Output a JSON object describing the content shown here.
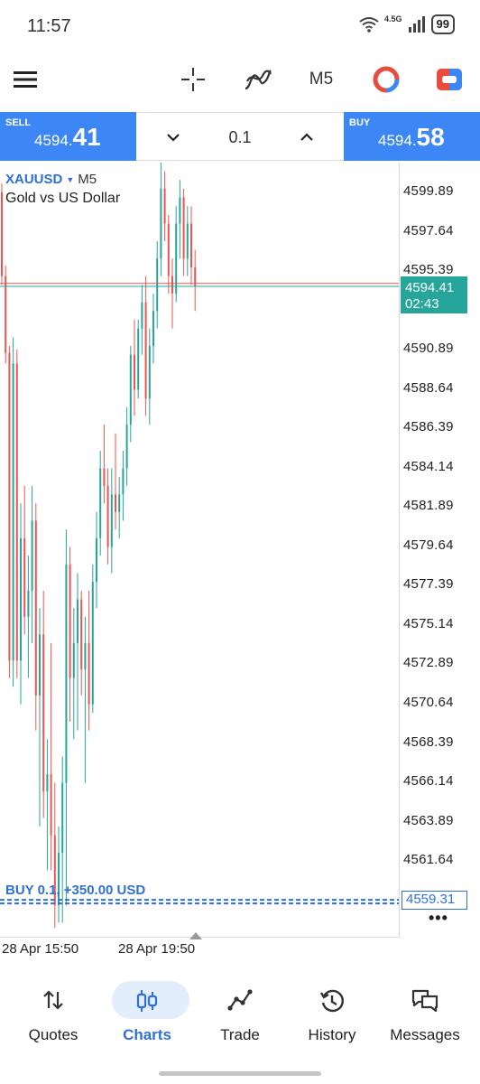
{
  "status_bar": {
    "time": "11:57",
    "network": "4.5G",
    "battery": "99"
  },
  "toolbar": {
    "menu_icon": "hamburger-menu-icon",
    "crosshair_icon": "crosshair-icon",
    "indicators_icon": "indicators-icon",
    "timeframe": "M5",
    "objects_icon": "chart-objects-icon",
    "color_scheme_icon": "color-scheme-icon"
  },
  "trade_bar": {
    "sell_label": "SELL",
    "sell_price_main": "4594.",
    "sell_price_big": "41",
    "volume": "0.1",
    "buy_label": "BUY",
    "buy_price_main": "4594.",
    "buy_price_big": "58",
    "colors": {
      "sell": "#3d86f5",
      "buy": "#3d86f5"
    }
  },
  "chart": {
    "symbol": "XAUUSD",
    "timeframe": "M5",
    "description": "Gold vs US Dollar",
    "price_axis": [
      "4599.89",
      "4597.64",
      "4595.39",
      "4590.89",
      "4588.64",
      "4586.39",
      "4584.14",
      "4581.89",
      "4579.64",
      "4577.39",
      "4575.14",
      "4572.89",
      "4570.64",
      "4568.39",
      "4566.14",
      "4563.89",
      "4561.64"
    ],
    "current_price": "4594.41",
    "countdown": "02:43",
    "position_label": "BUY 0.1, +350.00 USD",
    "position_price": "4559.31",
    "time_labels": [
      "28 Apr 15:50",
      "28 Apr 19:50"
    ],
    "colors": {
      "bull": "#26a69a",
      "bear": "#ef5350",
      "position": "#2f6fd8"
    }
  },
  "chart_data": {
    "type": "candlestick",
    "title": "",
    "symbol": "XAUUSD",
    "timeframe": "M5",
    "ylim": [
      4558.5,
      4601.5
    ],
    "candles_ohlc": [
      [
        4599.8,
        4600.3,
        4594.5,
        4595.0
      ],
      [
        4595.0,
        4595.6,
        4590.0,
        4590.6
      ],
      [
        4590.6,
        4591.0,
        4572.0,
        4573.0
      ],
      [
        4573.0,
        4591.5,
        4571.5,
        4590.0
      ],
      [
        4590.0,
        4590.8,
        4572.0,
        4573.0
      ],
      [
        4573.0,
        4582.0,
        4570.5,
        4580.0
      ],
      [
        4580.0,
        4583.0,
        4574.5,
        4575.5
      ],
      [
        4575.5,
        4579.0,
        4572.0,
        4577.0
      ],
      [
        4577.0,
        4583.0,
        4574.0,
        4581.0
      ],
      [
        4581.0,
        4582.0,
        4569.0,
        4571.0
      ],
      [
        4571.0,
        4576.0,
        4563.5,
        4574.5
      ],
      [
        4574.5,
        4577.0,
        4564.0,
        4565.5
      ],
      [
        4565.5,
        4568.5,
        4561.0,
        4566.5
      ],
      [
        4566.5,
        4574.0,
        4561.0,
        4563.0
      ],
      [
        4563.0,
        4566.0,
        4557.7,
        4559.0
      ],
      [
        4559.0,
        4563.5,
        4558.0,
        4562.0
      ],
      [
        4562.0,
        4567.5,
        4558.0,
        4566.0
      ],
      [
        4566.0,
        4580.5,
        4559.0,
        4578.5
      ],
      [
        4578.5,
        4579.5,
        4569.5,
        4572.0
      ],
      [
        4572.0,
        4576.0,
        4568.5,
        4574.0
      ],
      [
        4574.0,
        4578.0,
        4569.0,
        4576.5
      ],
      [
        4576.5,
        4577.0,
        4571.0,
        4572.5
      ],
      [
        4572.5,
        4575.5,
        4566.0,
        4574.0
      ],
      [
        4574.0,
        4577.0,
        4569.0,
        4570.5
      ],
      [
        4570.5,
        4578.5,
        4570.0,
        4577.5
      ],
      [
        4577.5,
        4581.5,
        4576.0,
        4580.0
      ],
      [
        4580.0,
        4585.0,
        4579.0,
        4584.0
      ],
      [
        4584.0,
        4586.5,
        4582.0,
        4583.0
      ],
      [
        4583.0,
        4584.0,
        4578.5,
        4579.5
      ],
      [
        4579.5,
        4584.0,
        4578.0,
        4582.5
      ],
      [
        4582.5,
        4586.0,
        4580.5,
        4581.5
      ],
      [
        4581.5,
        4583.5,
        4580.0,
        4582.5
      ],
      [
        4582.5,
        4585.0,
        4581.0,
        4584.0
      ],
      [
        4584.0,
        4587.5,
        4583.0,
        4586.5
      ],
      [
        4586.5,
        4591.0,
        4585.5,
        4590.5
      ],
      [
        4590.5,
        4592.5,
        4587.0,
        4588.5
      ],
      [
        4588.5,
        4592.5,
        4588.0,
        4592.0
      ],
      [
        4592.0,
        4594.5,
        4590.5,
        4593.5
      ],
      [
        4593.5,
        4595.0,
        4587.0,
        4588.0
      ],
      [
        4588.0,
        4592.0,
        4586.5,
        4591.0
      ],
      [
        4591.0,
        4594.0,
        4590.0,
        4593.0
      ],
      [
        4593.0,
        4597.0,
        4592.0,
        4596.0
      ],
      [
        4596.0,
        4601.5,
        4595.0,
        4600.0
      ],
      [
        4600.0,
        4601.0,
        4597.0,
        4598.0
      ],
      [
        4598.0,
        4598.5,
        4594.0,
        4595.0
      ],
      [
        4595.0,
        4596.0,
        4592.0,
        4594.0
      ],
      [
        4594.0,
        4599.0,
        4593.5,
        4598.0
      ],
      [
        4598.0,
        4600.5,
        4596.0,
        4599.5
      ],
      [
        4599.5,
        4600.0,
        4595.0,
        4596.0
      ],
      [
        4596.0,
        4599.0,
        4595.0,
        4598.0
      ],
      [
        4598.0,
        4599.0,
        4594.5,
        4595.5
      ],
      [
        4595.5,
        4596.5,
        4593.0,
        4594.41
      ]
    ],
    "bid_line": 4594.41,
    "ask_line": 4594.58,
    "position_line": 4559.31,
    "grid": false
  },
  "bottom_nav": {
    "items": [
      {
        "label": "Quotes",
        "icon": "quotes-icon",
        "active": false
      },
      {
        "label": "Charts",
        "icon": "charts-icon",
        "active": true
      },
      {
        "label": "Trade",
        "icon": "trade-icon",
        "active": false
      },
      {
        "label": "History",
        "icon": "history-icon",
        "active": false
      },
      {
        "label": "Messages",
        "icon": "messages-icon",
        "active": false
      }
    ]
  }
}
